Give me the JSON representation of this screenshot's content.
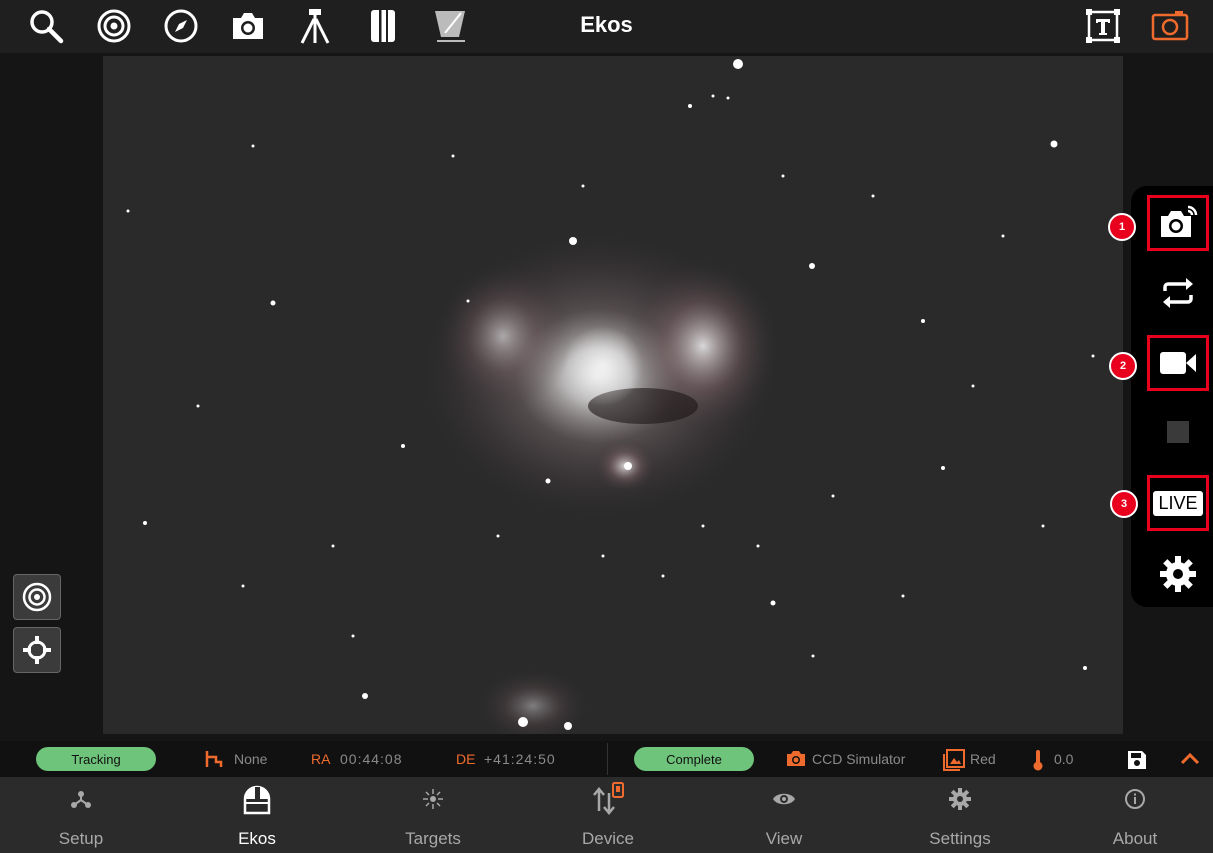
{
  "app": {
    "title": "Ekos"
  },
  "toolbar": {
    "left_icons": [
      "search-icon",
      "target-icon",
      "compass-icon",
      "camera-icon",
      "tripod-icon",
      "notebook-icon",
      "flat-panel-icon"
    ],
    "right_icons": [
      "text-overlay-icon",
      "capture-preview-icon"
    ],
    "accent": "#ef6b2d"
  },
  "capture_panel": {
    "badges": [
      "1",
      "2",
      "3"
    ],
    "live_label": "LIVE",
    "highlight_color": "#e8001c"
  },
  "status": {
    "mount_state": "Tracking",
    "pier_side": "None",
    "ra_label": "RA",
    "ra_value": "00:44:08",
    "de_label": "DE",
    "de_value": "+41:24:50",
    "capture_state": "Complete",
    "camera": "CCD Simulator",
    "filter": "Red",
    "temperature": "0.0",
    "pill_color": "#6ec47a"
  },
  "nav": {
    "items": [
      {
        "label": "Setup",
        "icon": "setup-icon"
      },
      {
        "label": "Ekos",
        "icon": "observatory-icon"
      },
      {
        "label": "Targets",
        "icon": "targets-icon"
      },
      {
        "label": "Device",
        "icon": "device-icon"
      },
      {
        "label": "View",
        "icon": "eye-icon"
      },
      {
        "label": "Settings",
        "icon": "gear-icon"
      },
      {
        "label": "About",
        "icon": "info-icon"
      }
    ],
    "active": "Ekos"
  }
}
